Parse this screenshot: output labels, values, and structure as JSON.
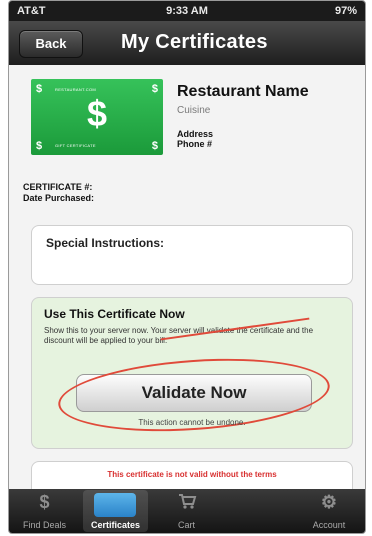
{
  "status_bar": {
    "carrier": "AT&T",
    "time": "9:33 AM",
    "battery": "97%"
  },
  "nav": {
    "back_label": "Back",
    "title": "My Certificates"
  },
  "gift_card": {
    "big_symbol": "$",
    "corner_symbol": "$",
    "top_text": "RESTAURANT.COM",
    "bottom_text": "GIFT CERTIFICATE",
    "color": "#2db04e"
  },
  "restaurant": {
    "name": "Restaurant Name",
    "cuisine": "Cuisine",
    "address": "Address",
    "phone": "Phone #"
  },
  "certificate": {
    "number_label": "CERTIFICATE #:",
    "date_label": "Date Purchased:"
  },
  "special_instructions": {
    "label": "Special Instructions:"
  },
  "use_section": {
    "title": "Use This Certificate Now",
    "description": "Show this to your server now. Your server will validate the certificate and the discount will be applied to your bill.",
    "validate_label": "Validate Now",
    "undone_text": "This action cannot be undone.",
    "annotation_color": "#e04a3a"
  },
  "terms": {
    "text": "This certificate is not valid without the terms"
  },
  "tabs": [
    {
      "label": "Find Deals",
      "icon": "dollar-icon",
      "glyph": "$"
    },
    {
      "label": "Certificates",
      "icon": "certificate-icon",
      "glyph": "",
      "active": true
    },
    {
      "label": "Cart",
      "icon": "cart-icon",
      "glyph": "🛒"
    },
    {
      "label": "Account",
      "icon": "gear-icon",
      "glyph": "⚙"
    }
  ]
}
